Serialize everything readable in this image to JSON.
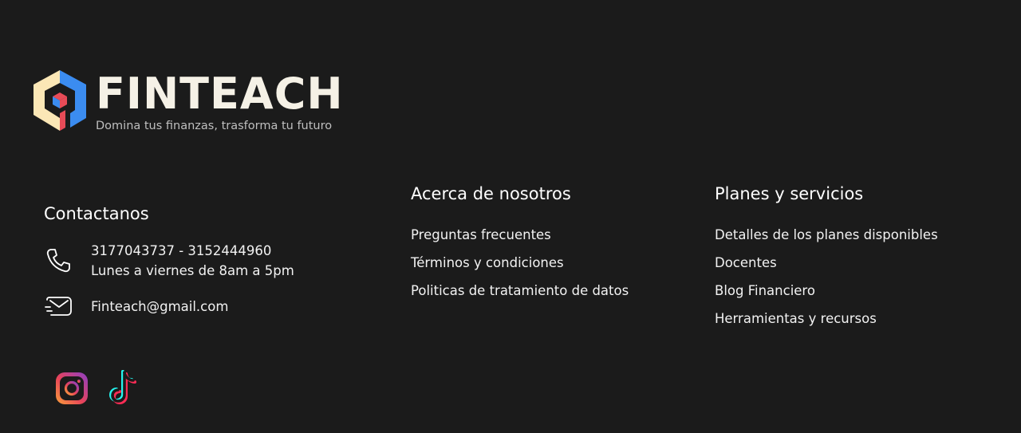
{
  "brand": {
    "name": "FINTEACH",
    "tagline": "Domina tus finanzas, trasforma tu futuro",
    "colors": {
      "blue": "#3b8cf0",
      "cream": "#fbe7b6",
      "red": "#e84b57",
      "word": "#f5f1e6"
    }
  },
  "contact": {
    "title": "Contactanos",
    "phones": "3177043737 - 3152444960",
    "hours": "Lunes a viernes de 8am a 5pm",
    "email": "Finteach@gmail.com",
    "phone_icon": "phone-icon",
    "mail_icon": "mail-icon"
  },
  "about": {
    "title": "Acerca de nosotros",
    "links": [
      "Preguntas frecuentes",
      "Términos y condiciones",
      "Politicas de tratamiento de datos"
    ]
  },
  "plans": {
    "title": "Planes y servicios",
    "links": [
      "Detalles de los planes disponibles",
      "Docentes",
      "Blog Financiero",
      "Herramientas y recursos"
    ]
  },
  "socials": [
    {
      "icon": "instagram-icon"
    },
    {
      "icon": "tiktok-icon"
    }
  ],
  "background": "#1b1b1b"
}
